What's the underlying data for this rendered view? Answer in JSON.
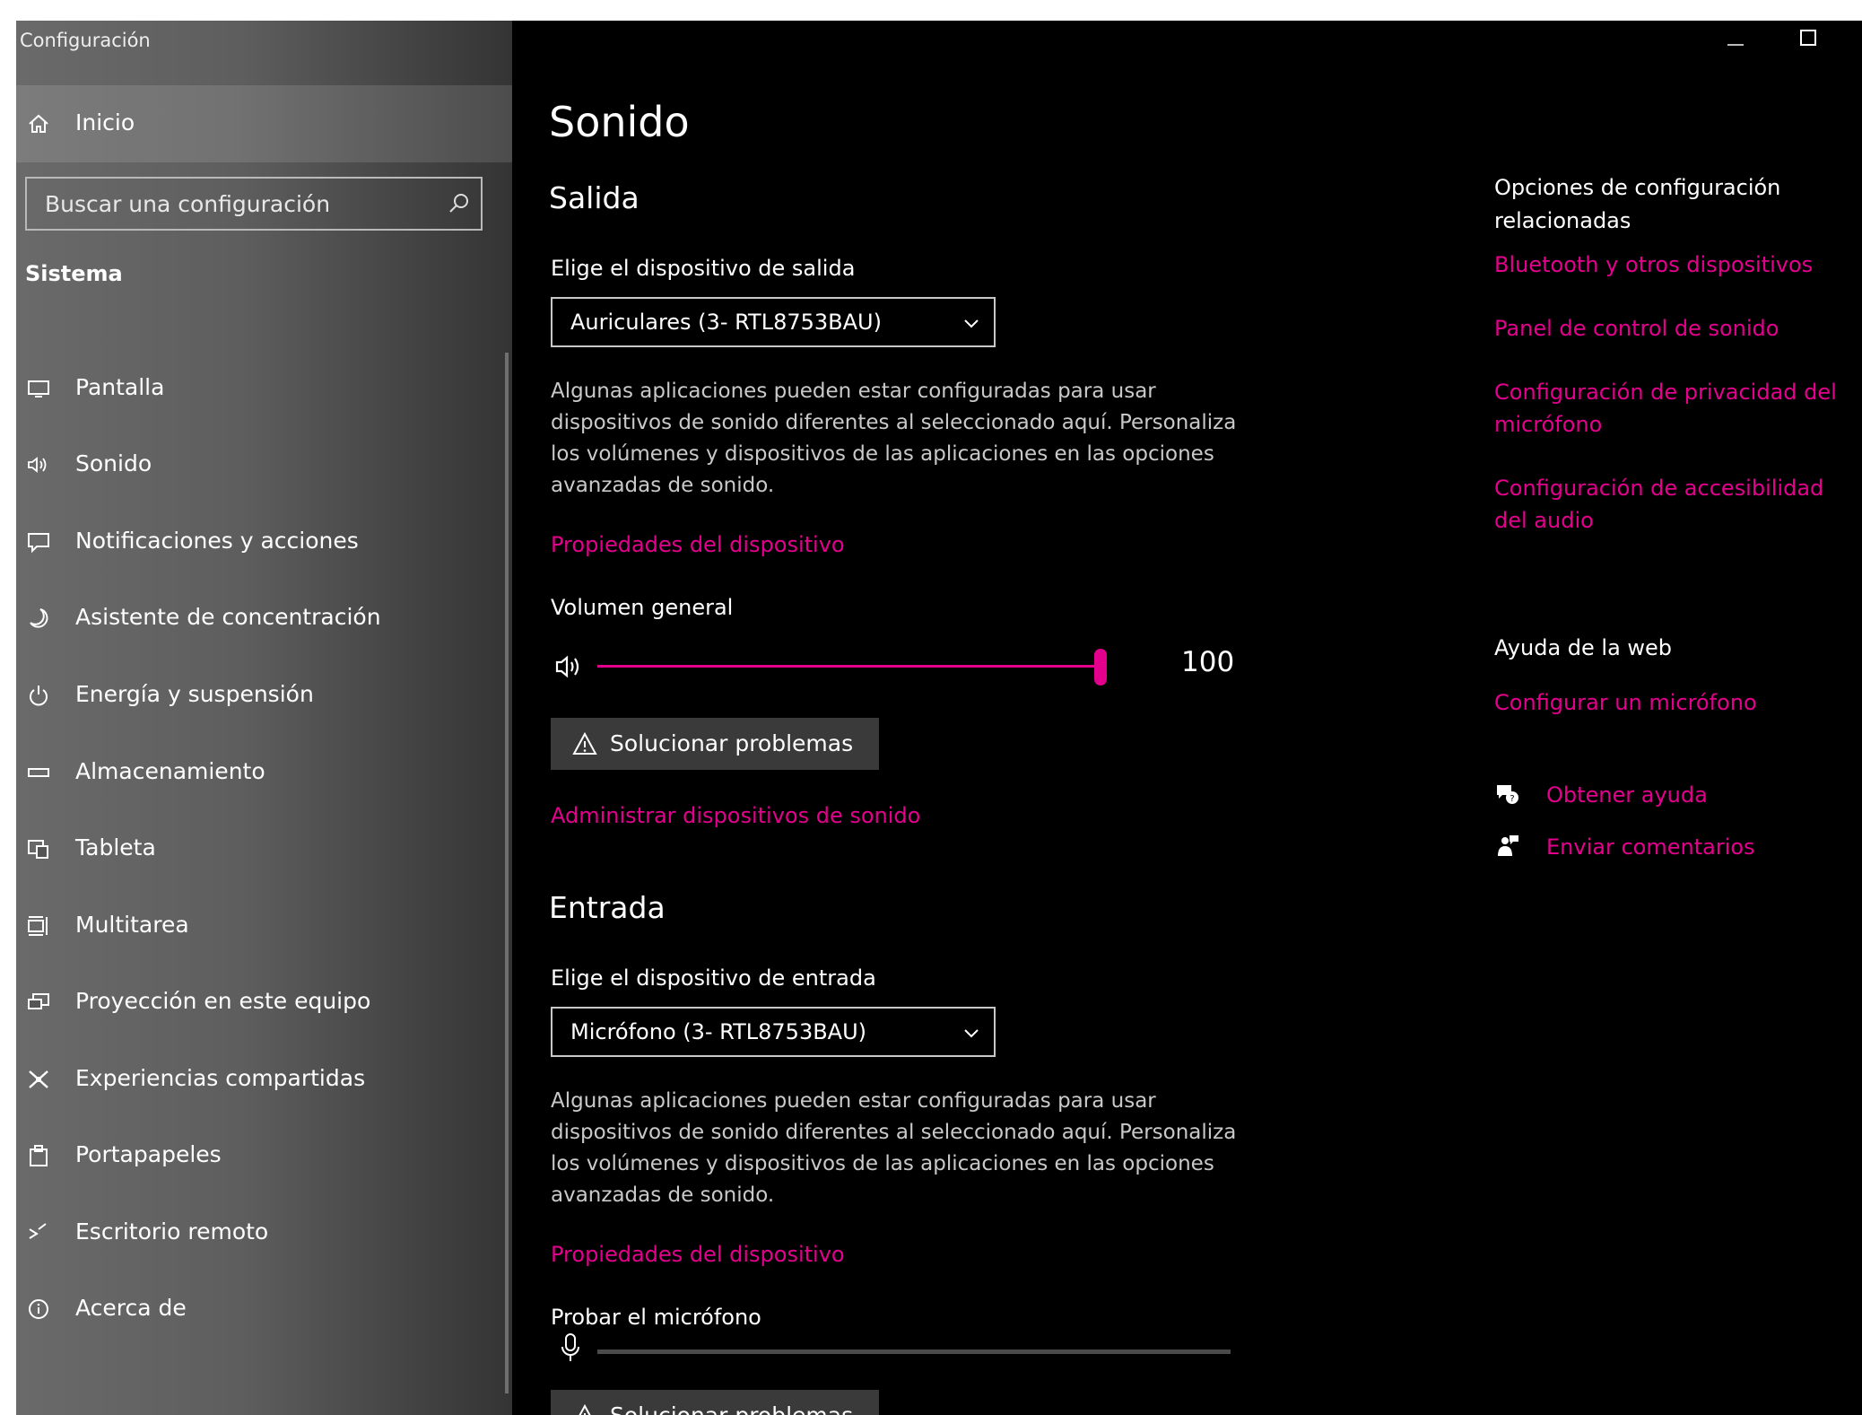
{
  "app": {
    "title": "Configuración"
  },
  "colors": {
    "accent": "#e3008c",
    "sidebar_bg": "#5e5e5e",
    "content_bg": "#000000"
  },
  "sidebar": {
    "home": {
      "label": "Inicio",
      "icon": "home-icon"
    },
    "search": {
      "placeholder": "Buscar una configuración",
      "value": ""
    },
    "section": "Sistema",
    "items": [
      {
        "label": "Pantalla",
        "icon": "monitor-icon"
      },
      {
        "label": "Sonido",
        "icon": "speaker-icon"
      },
      {
        "label": "Notificaciones y acciones",
        "icon": "notifications-icon"
      },
      {
        "label": "Asistente de concentración",
        "icon": "moon-icon"
      },
      {
        "label": "Energía y suspensión",
        "icon": "power-icon"
      },
      {
        "label": "Almacenamiento",
        "icon": "storage-icon"
      },
      {
        "label": "Tableta",
        "icon": "tablet-icon"
      },
      {
        "label": "Multitarea",
        "icon": "multitask-icon"
      },
      {
        "label": "Proyección en este equipo",
        "icon": "projection-icon"
      },
      {
        "label": "Experiencias compartidas",
        "icon": "shared-experiences-icon"
      },
      {
        "label": "Portapapeles",
        "icon": "clipboard-icon"
      },
      {
        "label": "Escritorio remoto",
        "icon": "remote-desktop-icon"
      },
      {
        "label": "Acerca de",
        "icon": "info-icon"
      }
    ]
  },
  "main": {
    "title": "Sonido",
    "output": {
      "heading": "Salida",
      "device_label": "Elige el dispositivo de salida",
      "device_value": "Auriculares (3- RTL8753BAU)",
      "desc": "Algunas aplicaciones pueden estar configuradas para usar dispositivos de sonido diferentes al seleccionado aquí. Personaliza los volúmenes y dispositivos de las aplicaciones en las opciones avanzadas de sonido.",
      "properties_link": "Propiedades del dispositivo",
      "volume_label": "Volumen general",
      "volume_value": "100",
      "volume_level": 1.0,
      "troubleshoot": "Solucionar problemas",
      "manage_link": "Administrar dispositivos de sonido"
    },
    "input": {
      "heading": "Entrada",
      "device_label": "Elige el dispositivo de entrada",
      "device_value": "Micrófono (3- RTL8753BAU)",
      "desc": "Algunas aplicaciones pueden estar configuradas para usar dispositivos de sonido diferentes al seleccionado aquí. Personaliza los volúmenes y dispositivos de las aplicaciones en las opciones avanzadas de sonido.",
      "properties_link": "Propiedades del dispositivo",
      "test_label": "Probar el micrófono",
      "troubleshoot": "Solucionar problemas"
    }
  },
  "related": {
    "heading": "Opciones de configuración relacionadas",
    "links": [
      "Bluetooth y otros dispositivos",
      "Panel de control de sonido",
      "Configuración de privacidad del micrófono",
      "Configuración de accesibilidad del audio"
    ],
    "web_help_heading": "Ayuda de la web",
    "web_help_link": "Configurar un micrófono",
    "get_help": "Obtener ayuda",
    "feedback": "Enviar comentarios"
  }
}
